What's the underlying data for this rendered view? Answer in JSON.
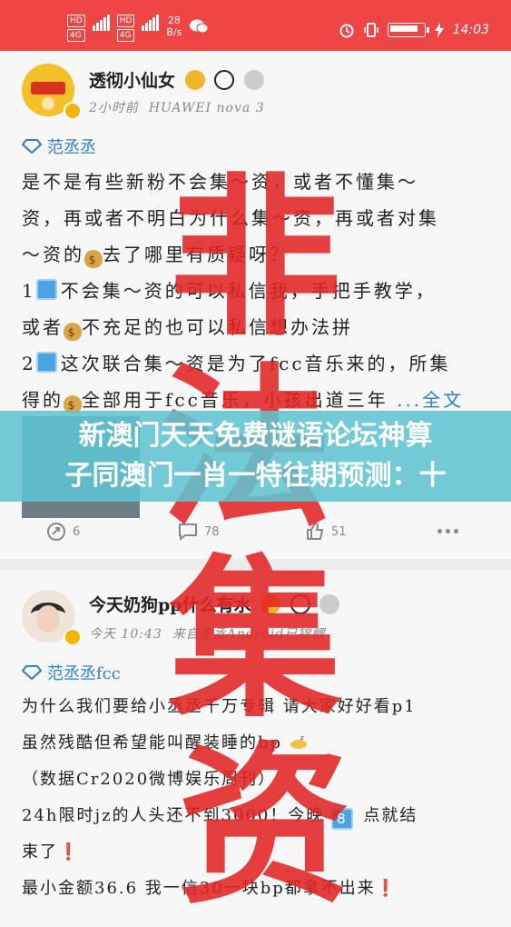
{
  "status_bar": {
    "sim1": "HD",
    "sim1_net": "4G",
    "sim2": "HD",
    "sim2_net": "4G",
    "speed_value": "28",
    "speed_unit": "B/s",
    "battery_percent": 90,
    "time": "14:03"
  },
  "post1": {
    "user": "透彻小仙女",
    "time": "2小时前",
    "device": "HUAWEI nova 3",
    "topic": "范丞丞",
    "lines": [
      "是不是有些新粉不会集～资，或者不懂集～",
      "资，再或者不明白为什么集～资，再或者对集",
      "～资的",
      "去了哪里有质疑呀？",
      "1",
      "不会集～资的可以私信我，手把手教学，",
      "或者",
      "不充足的也可以私信想办法拼",
      "2",
      "这次联合集～资是为了fcc音乐来的，所集",
      "得的",
      "全部用于fcc音乐，小孩出道三年",
      "...全文"
    ],
    "actions": {
      "forward": "6",
      "comment": "78",
      "like": "51"
    }
  },
  "post2": {
    "user": "今天奶狗pp什么有水",
    "time": "今天 10:43",
    "device": "来自丞丞Android已锦鲤",
    "topic": "范丞丞fcc",
    "lines": [
      "为什么我们要给小丞丞千万专辑 请大家好好看p1",
      "虽然残酷但希望能叫醒装睡的bp",
      "（数据Cr2020微博娱乐周刊）",
      "24h限时jz的人头还不到3000！今晚",
      "8",
      "点就结",
      "束了",
      "最小金额36.6 我一信30一块bp都拿不出来"
    ]
  },
  "overlay_banner": {
    "line1": "新澳门天天免费谜语论坛神算",
    "line2": "子同澳门一肖一特往期预测：十"
  },
  "stamp_chars": [
    "非",
    "法",
    "集",
    "资"
  ],
  "colors": {
    "status_bar": "#f04545",
    "stamp": "#e22424",
    "banner": "#5fc4d2",
    "link": "#2c7fd1"
  }
}
